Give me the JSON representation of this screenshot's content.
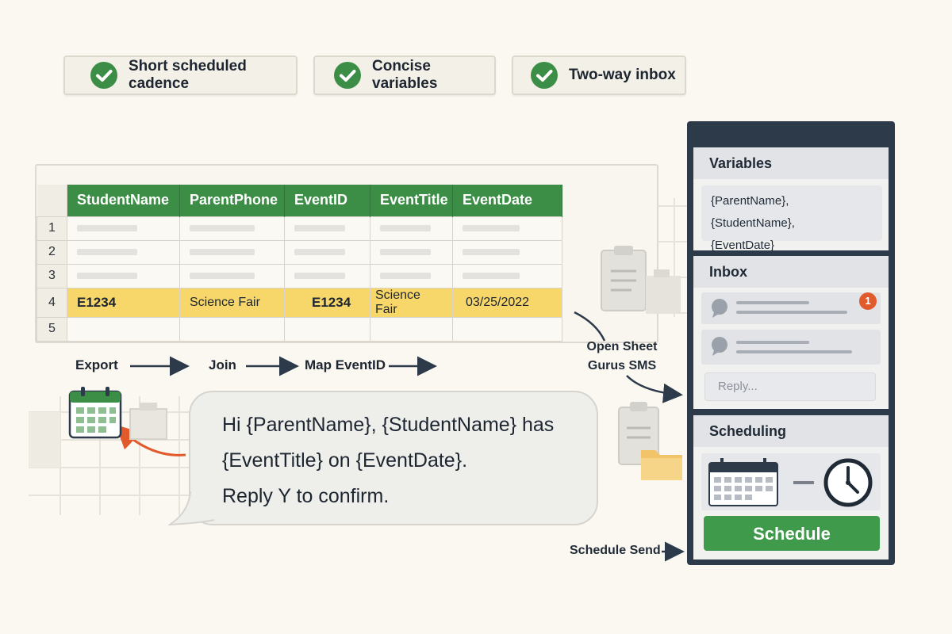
{
  "features": [
    {
      "label": "Short scheduled cadence"
    },
    {
      "label": "Concise variables"
    },
    {
      "label": "Two-way inbox"
    }
  ],
  "sheet": {
    "columns": [
      "StudentName",
      "ParentPhone",
      "EventID",
      "EventTitle",
      "EventDate"
    ],
    "row_numbers": [
      "1",
      "2",
      "3",
      "4",
      "5"
    ],
    "highlight_row": [
      "E1234",
      "Science Fair",
      "E1234",
      "Science Fair",
      "03/25/2022"
    ]
  },
  "flow": {
    "export": "Export",
    "join": "Join",
    "map": "Map EventID",
    "open_sms": "Open Sheet Gurus SMS",
    "schedule_send": "Schedule Send"
  },
  "message": {
    "line1": "Hi {ParentName}, {StudentName} has",
    "line2": "{EventTitle} on {EventDate}.",
    "line3": "Reply Y to confirm."
  },
  "panel": {
    "variables": {
      "title": "Variables",
      "line1": "{ParentName}, {StudentName},",
      "line2": "{EventDate}"
    },
    "inbox": {
      "title": "Inbox",
      "badge": "1",
      "reply_placeholder": "Reply..."
    },
    "scheduling": {
      "title": "Scheduling",
      "button": "Schedule"
    }
  },
  "colors": {
    "green": "#3c8d45",
    "highlight": "#f7d76a",
    "accent_orange": "#e05a2c",
    "panel_dark": "#2d3a4a"
  },
  "icons": [
    "check-circle-icon",
    "calendar-icon",
    "clipboard-icon",
    "folder-icon",
    "chat-bubble-icon",
    "clock-icon",
    "arrow-icon"
  ]
}
